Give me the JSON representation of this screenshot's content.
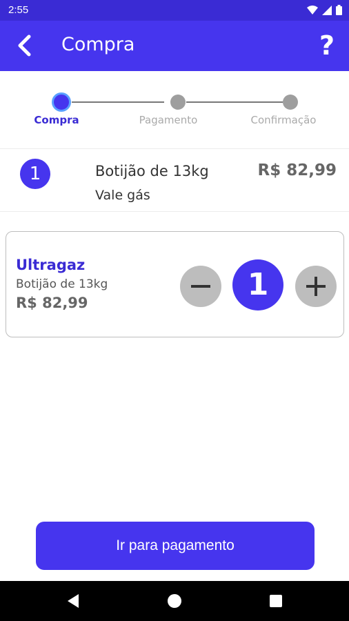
{
  "status_bar": {
    "time": "2:55"
  },
  "app_bar": {
    "title": "Compra",
    "help_label": "?"
  },
  "stepper": {
    "steps": [
      {
        "label": "Compra"
      },
      {
        "label": "Pagamento"
      },
      {
        "label": "Confirmação"
      }
    ]
  },
  "summary": {
    "quantity": "1",
    "product": "Botijão de 13kg",
    "subtitle": "Vale gás",
    "price": "R$ 82,99"
  },
  "card": {
    "brand": "Ultragaz",
    "product": "Botijão de 13kg",
    "price": "R$ 82,99",
    "quantity": "1"
  },
  "actions": {
    "pay_label": "Ir para pagamento"
  },
  "colors": {
    "primary": "#4635ee",
    "status_bar": "#3a2bd4",
    "inactive_dot": "#9e9e9e"
  }
}
